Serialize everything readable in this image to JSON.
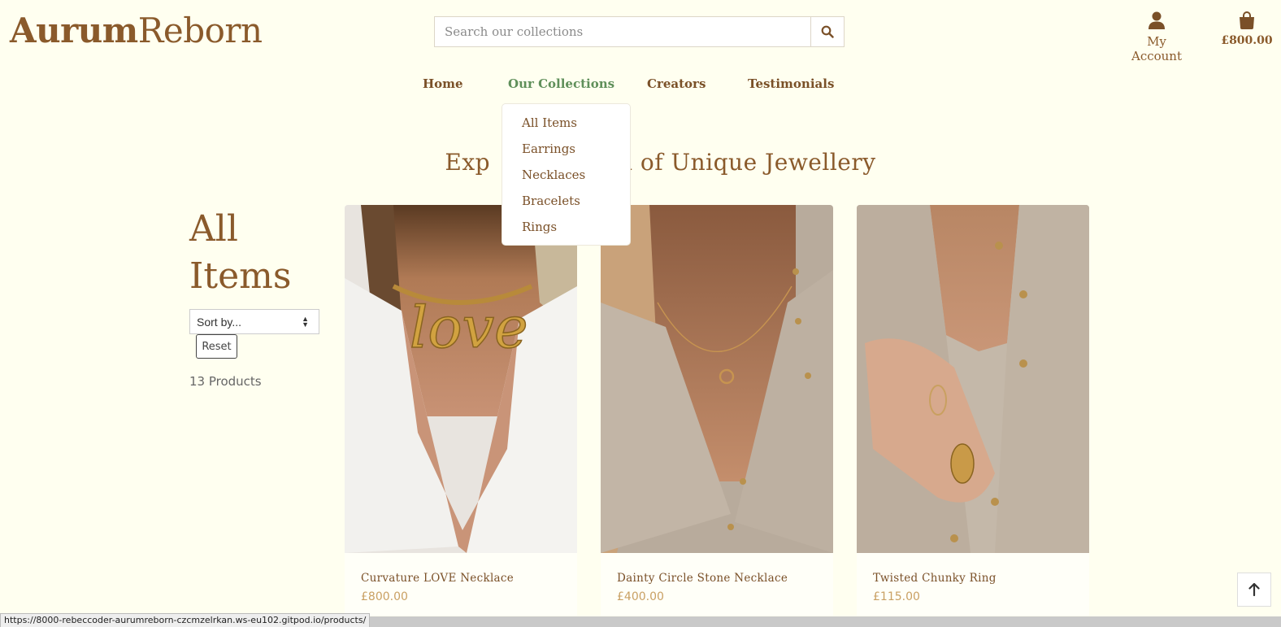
{
  "brand": {
    "part1": "Aurum",
    "part2": "Reborn",
    "color": "#8a5a2b"
  },
  "search": {
    "placeholder": "Search our collections",
    "icon": "search-icon"
  },
  "account": {
    "label": "My Account",
    "icon": "user-icon"
  },
  "bag": {
    "total": "£800.00",
    "icon": "shopping-bag-icon"
  },
  "nav": {
    "items": [
      {
        "label": "Home"
      },
      {
        "label": "Our Collections",
        "active": true
      },
      {
        "label": "Creators"
      },
      {
        "label": "Testimonials"
      }
    ],
    "active_color": "#5f8f5a"
  },
  "dropdown": {
    "items": [
      {
        "label": "All Items"
      },
      {
        "label": "Earrings"
      },
      {
        "label": "Necklaces"
      },
      {
        "label": "Bracelets"
      },
      {
        "label": "Rings"
      }
    ]
  },
  "tagline": {
    "left": "Exp",
    "right": "d of Unique Jewellery"
  },
  "sidebar": {
    "heading_line1": "All",
    "heading_line2": "Items",
    "sort_label": "Sort by...",
    "reset_label": "Reset",
    "count": "13 Products"
  },
  "products": [
    {
      "name": "Curvature LOVE Necklace",
      "price": "£800.00"
    },
    {
      "name": "Dainty Circle Stone Necklace",
      "price": "£400.00"
    },
    {
      "name": "Twisted Chunky Ring",
      "price": "£115.00"
    }
  ],
  "back_to_top": {
    "icon": "arrow-up-icon"
  },
  "status_url": "https://8000-rebeccoder-aurumreborn-czcmzelrkan.ws-eu102.gitpod.io/products/"
}
